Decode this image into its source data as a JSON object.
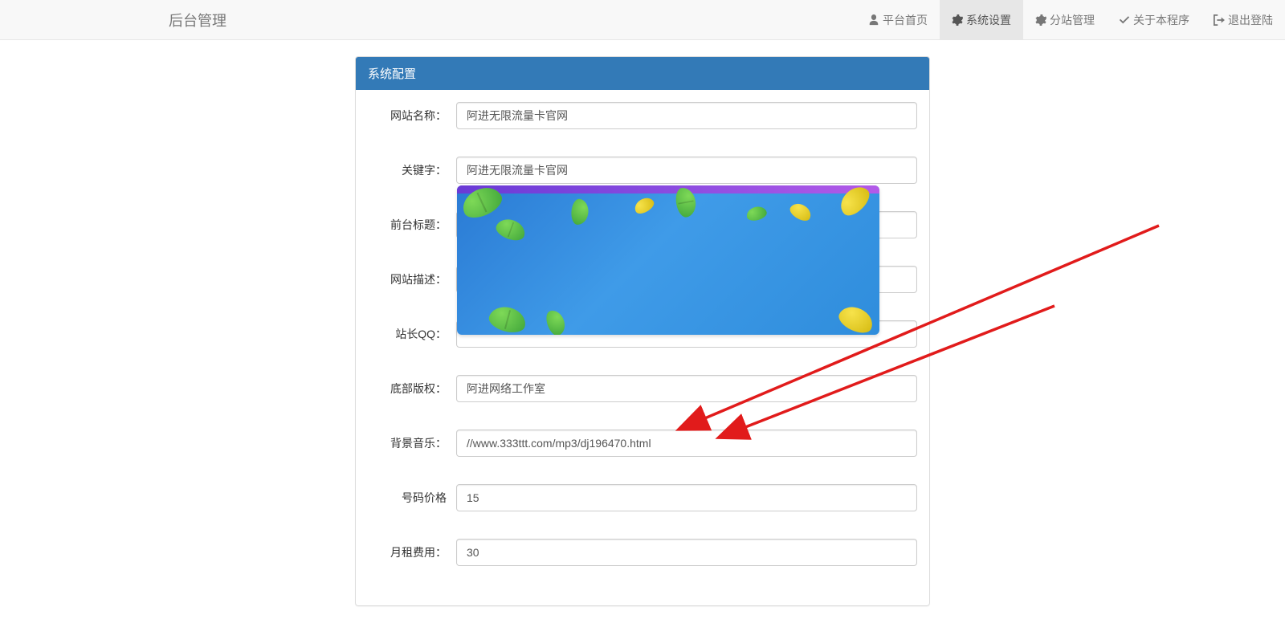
{
  "navbar": {
    "brand": "后台管理",
    "items": [
      {
        "icon": "user",
        "label": "平台首页"
      },
      {
        "icon": "gear",
        "label": "系统设置",
        "active": true
      },
      {
        "icon": "gear",
        "label": "分站管理"
      },
      {
        "icon": "check",
        "label": "关于本程序"
      },
      {
        "icon": "signout",
        "label": "退出登陆"
      }
    ]
  },
  "panel": {
    "title": "系统配置",
    "form_labels": {
      "site_name": "网站名称：",
      "keywords": "关键字：",
      "front_title": "前台标题：",
      "description": "网站描述：",
      "webmaster_qq": "站长QQ：",
      "footer": "底部版权：",
      "bg_music": "背景音乐：",
      "price": "号码价格",
      "monthly": "月租费用："
    },
    "form_values": {
      "site_name": "阿进无限流量卡官网",
      "keywords": "阿进无限流量卡官网",
      "front_title": "",
      "description": "",
      "webmaster_qq": "",
      "footer": "阿进网络工作室",
      "bg_music": "//www.333ttt.com/mp3/dj196470.html",
      "price": "15",
      "monthly": "30"
    }
  },
  "annotations": {
    "arrow_color": "#e11b1b"
  }
}
